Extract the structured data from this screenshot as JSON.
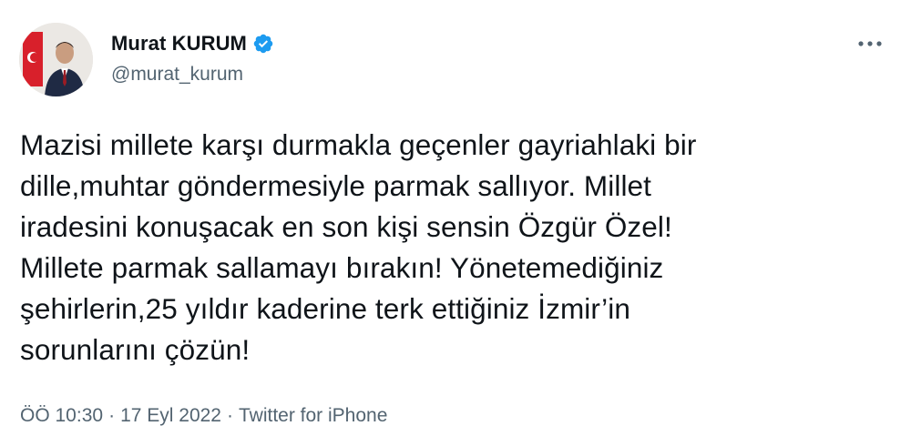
{
  "tweet": {
    "author": {
      "display_name": "Murat KURUM",
      "handle": "@murat_kurum",
      "verified": true,
      "verified_color": "#1d9bf0",
      "avatar_icon": "profile-photo"
    },
    "text": "Mazisi millete karşı durmakla geçenler gayriahlaki bir\ndille,muhtar göndermesiyle parmak sallıyor. Millet\niradesini konuşacak en son kişi sensin Özgür Özel!\nMillete parmak sallamayı bırakın! Yönetemediğiniz\nşehirlerin,25 yıldır kaderine terk ettiğiniz İzmir’in\nsorunlarını çözün!",
    "time": "ÖÖ 10:30",
    "separator": "·",
    "date": "17 Eyl 2022",
    "source": "Twitter for iPhone",
    "more_icon": "more-horizontal-icon"
  }
}
